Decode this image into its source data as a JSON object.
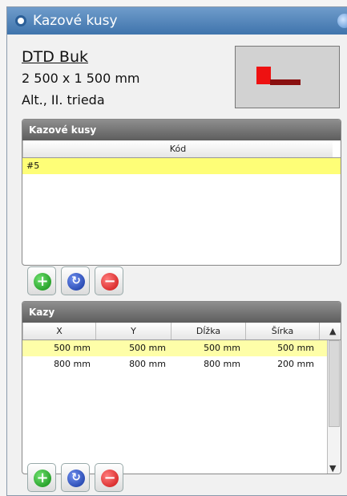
{
  "window": {
    "title": "Kazové kusy"
  },
  "material": {
    "name": "DTD Buk",
    "size": "2 500 x 1 500 mm",
    "grade": "Alt., II. trieda"
  },
  "panel1": {
    "title": "Kazové kusy",
    "column_header": "Kód",
    "rows": [
      "#5"
    ]
  },
  "panel2": {
    "title": "Kazy",
    "columns": [
      "X",
      "Y",
      "Dĺžka",
      "Šírka"
    ],
    "rows": [
      [
        "500 mm",
        "500 mm",
        "500 mm",
        "500 mm"
      ],
      [
        "800 mm",
        "800 mm",
        "800 mm",
        "200 mm"
      ]
    ]
  },
  "buttons": {
    "add": "+",
    "refresh": "↻",
    "remove": "−"
  }
}
